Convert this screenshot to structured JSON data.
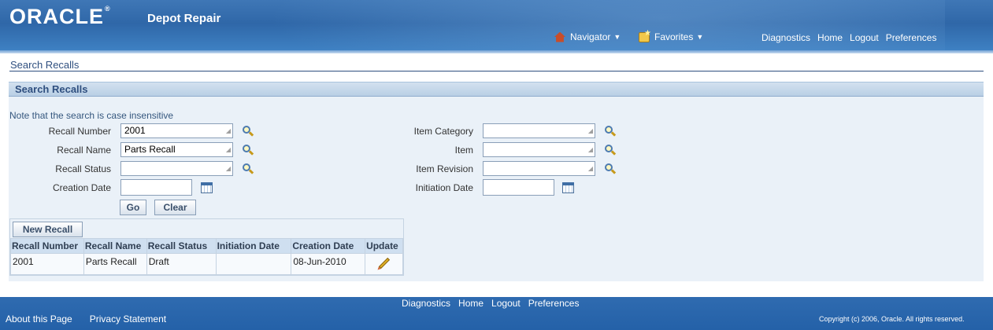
{
  "header": {
    "brand": "ORACLE",
    "brand_reg": "®",
    "app_title": "Depot Repair",
    "navigator_label": "Navigator",
    "favorites_label": "Favorites",
    "global_links": [
      "Diagnostics",
      "Home",
      "Logout",
      "Preferences"
    ]
  },
  "page_title": "Search Recalls",
  "region": {
    "title": "Search Recalls",
    "note": "Note that the search is case insensitive",
    "fields_left": [
      {
        "label": "Recall Number",
        "value": "2001"
      },
      {
        "label": "Recall Name",
        "value": "Parts Recall"
      },
      {
        "label": "Recall Status",
        "value": ""
      },
      {
        "label": "Creation Date",
        "value": ""
      }
    ],
    "fields_right": [
      {
        "label": "Item Category",
        "value": ""
      },
      {
        "label": "Item",
        "value": ""
      },
      {
        "label": "Item Revision",
        "value": ""
      },
      {
        "label": "Initiation Date",
        "value": ""
      }
    ],
    "go_label": "Go",
    "clear_label": "Clear"
  },
  "results": {
    "new_button_label": "New Recall",
    "columns": [
      "Recall Number",
      "Recall Name",
      "Recall Status",
      "Initiation Date",
      "Creation Date",
      "Update"
    ],
    "rows": [
      {
        "recall_number": "2001",
        "recall_name": "Parts Recall",
        "recall_status": "Draft",
        "initiation_date": "",
        "creation_date": "08-Jun-2010",
        "update_icon": "pencil-icon"
      }
    ]
  },
  "footer": {
    "links": [
      "Diagnostics",
      "Home",
      "Logout",
      "Preferences"
    ],
    "about": "About this Page",
    "privacy": "Privacy Statement",
    "copyright": "Copyright (c) 2006, Oracle. All rights reserved."
  },
  "colors": {
    "header_blue": "#2f67a8",
    "region_bg": "#eaf1f8",
    "title_text": "#2f4f7f",
    "footer_blue": "#2461a8"
  }
}
